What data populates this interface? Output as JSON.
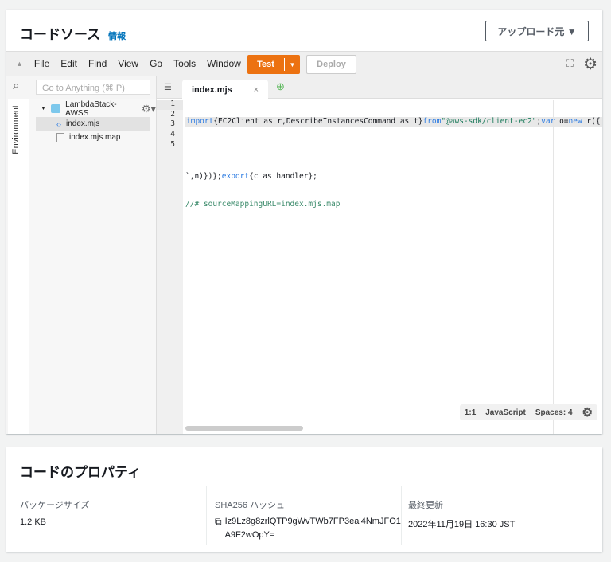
{
  "code_source": {
    "title": "コードソース",
    "info_link": "情報",
    "upload_button": "アップロード元 ▼"
  },
  "toolbar": {
    "menus": [
      "File",
      "Edit",
      "Find",
      "View",
      "Go",
      "Tools",
      "Window"
    ],
    "test_label": "Test",
    "deploy_label": "Deploy"
  },
  "sidebar": {
    "search_placeholder": "Go to Anything (⌘ P)",
    "env_tab": "Environment",
    "folder": "LambdaStack-AWSS",
    "files": [
      "index.mjs",
      "index.mjs.map"
    ]
  },
  "editor": {
    "tab": "index.mjs",
    "lines": [
      "1",
      "2",
      "3",
      "4",
      "5"
    ],
    "code": {
      "l1a": "import",
      "l1b": "{EC2Client as r,DescribeInstancesCommand as t}",
      "l1c": "from",
      "l1d": "\"@aws-sdk/client-ec2\"",
      "l1e": ";",
      "l1f": "var",
      "l1g": " o=",
      "l1h": "new",
      "l1i": " r({",
      "l3a": "`,n)})};",
      "l3b": "export",
      "l3c": "{c as handler};",
      "l4": "//# sourceMappingURL=index.mjs.map"
    },
    "status": {
      "position": "1:1",
      "language": "JavaScript",
      "spaces": "Spaces: 4"
    }
  },
  "properties": {
    "title": "コードのプロパティ",
    "package_size_label": "パッケージサイズ",
    "package_size": "1.2 KB",
    "sha_label": "SHA256 ハッシュ",
    "sha": "Iz9Lz8g8zrlQTP9gWvTWb7FP3eai4NmJFO1A9F2wOpY=",
    "modified_label": "最終更新",
    "modified": "2022年11月19日 16:30 JST"
  }
}
